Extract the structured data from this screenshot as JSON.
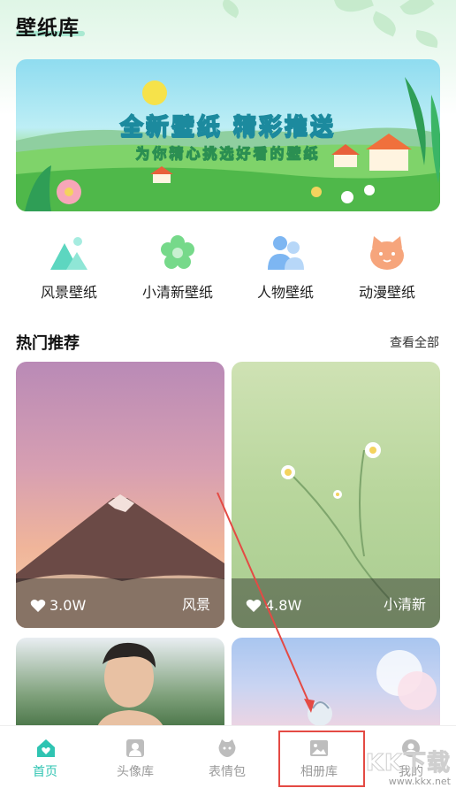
{
  "header": {
    "title": "壁纸库"
  },
  "banner": {
    "title": "全新壁纸 精彩推送",
    "subtitle": "为你精心挑选好看的壁纸"
  },
  "categories": [
    {
      "label": "风景壁纸",
      "icon": "mountain-icon",
      "color": "#5dd6c0"
    },
    {
      "label": "小清新壁纸",
      "icon": "flower-icon",
      "color": "#76d98a"
    },
    {
      "label": "人物壁纸",
      "icon": "people-icon",
      "color": "#7db6f2"
    },
    {
      "label": "动漫壁纸",
      "icon": "cat-icon",
      "color": "#f6a57c"
    }
  ],
  "hot": {
    "title": "热门推荐",
    "view_all": "查看全部",
    "cards": [
      {
        "likes": "3.0W",
        "tag": "风景"
      },
      {
        "likes": "4.8W",
        "tag": "小清新"
      }
    ]
  },
  "bottom_nav": {
    "items": [
      {
        "label": "首页",
        "icon": "home-icon",
        "active": true
      },
      {
        "label": "头像库",
        "icon": "avatar-icon",
        "active": false
      },
      {
        "label": "表情包",
        "icon": "emoji-icon",
        "active": false
      },
      {
        "label": "相册库",
        "icon": "album-icon",
        "active": false
      },
      {
        "label": "我的",
        "icon": "profile-icon",
        "active": false
      }
    ]
  },
  "watermark": {
    "main": "KK下载",
    "sub": "www.kkx.net"
  },
  "colors": {
    "accent": "#2fc4b2",
    "annotation": "#e44a44"
  }
}
